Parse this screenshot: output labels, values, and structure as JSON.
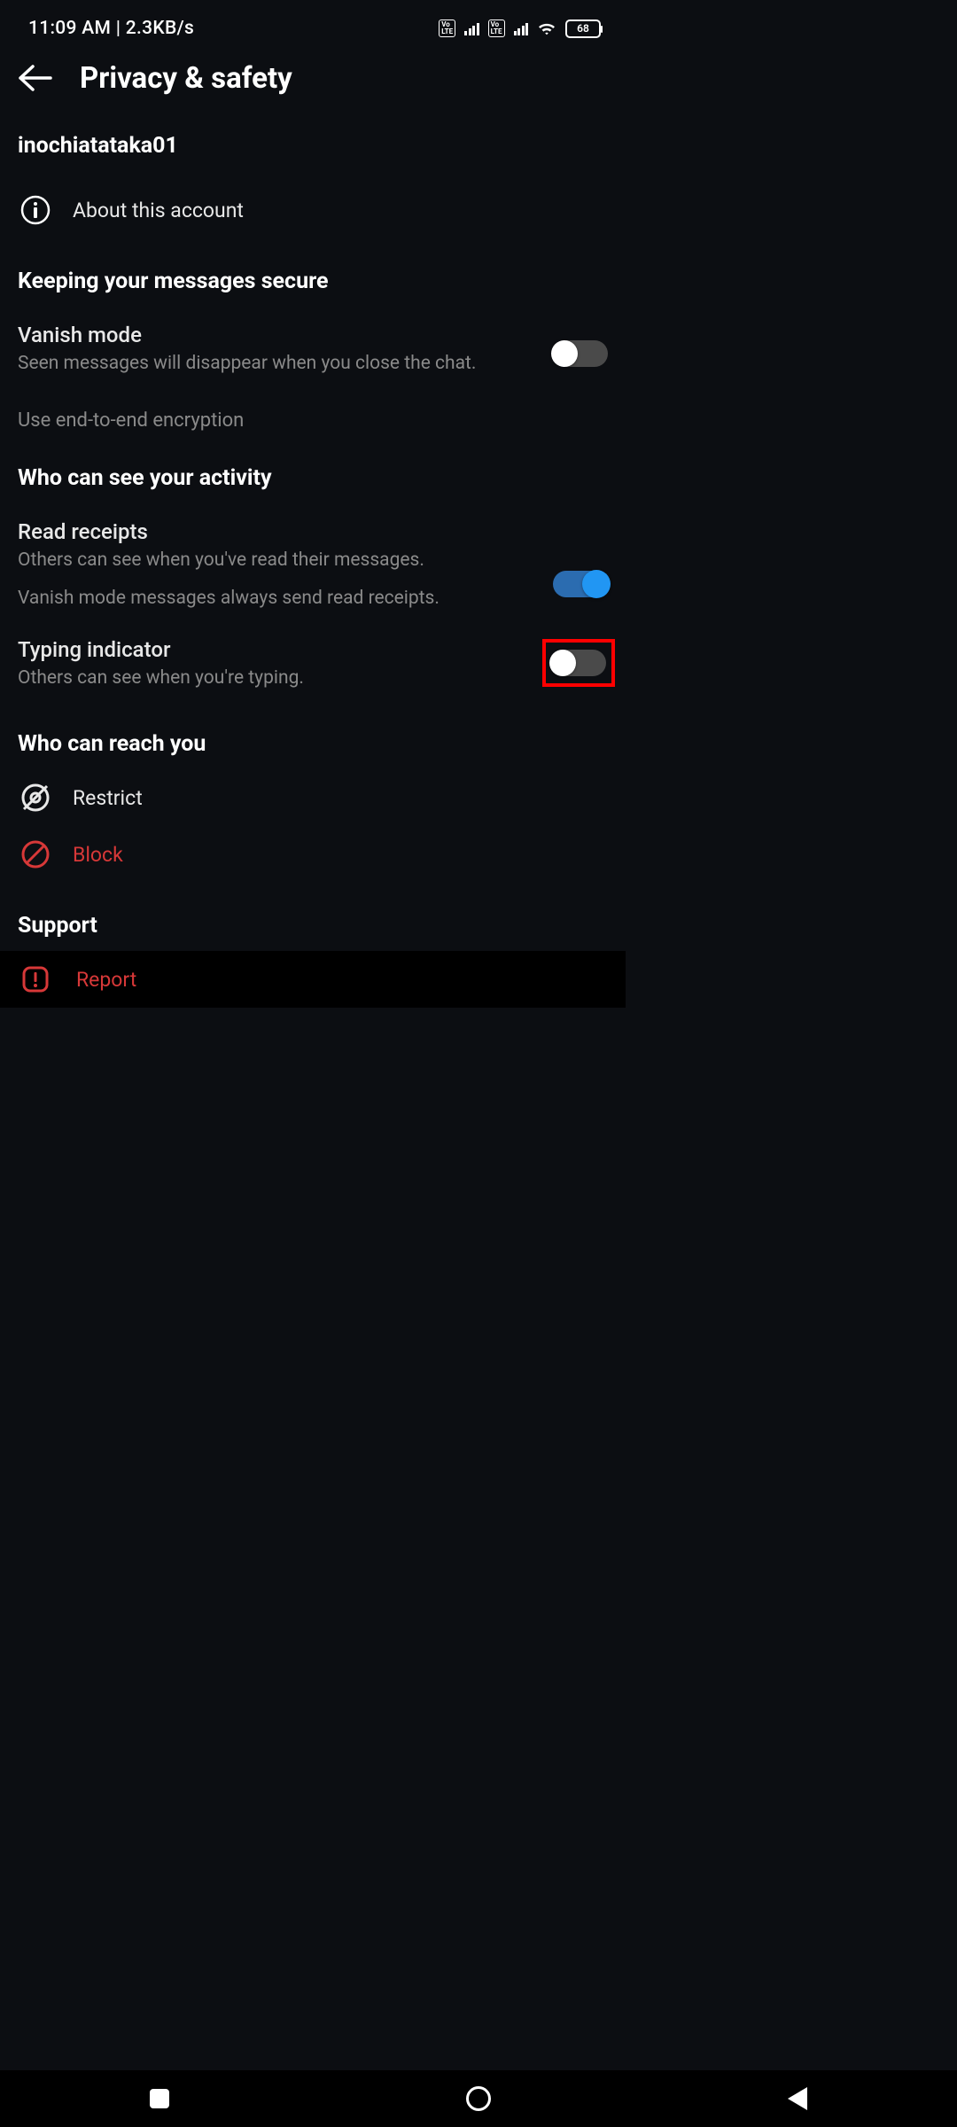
{
  "status": {
    "time": "11:09 AM",
    "net_speed": "2.3KB/s",
    "volte": "Vo\nLTE",
    "battery_pct": "68"
  },
  "header": {
    "title": "Privacy & safety"
  },
  "account": {
    "username": "inochiatataka01",
    "about_label": "About this account"
  },
  "sections": {
    "secure_heading": "Keeping your messages secure",
    "activity_heading": "Who can see your activity",
    "reach_heading": "Who can reach you",
    "support_heading": "Support"
  },
  "settings": {
    "vanish": {
      "title": "Vanish mode",
      "desc": "Seen messages will disappear when you close the chat.",
      "on": false
    },
    "e2e_label": "Use end-to-end encryption",
    "read_receipts": {
      "title": "Read receipts",
      "desc": "Others can see when you've read their messages.",
      "note": "Vanish mode messages always send read receipts.",
      "on": true
    },
    "typing": {
      "title": "Typing indicator",
      "desc": "Others can see when you're typing.",
      "on": false
    }
  },
  "actions": {
    "restrict": "Restrict",
    "block": "Block",
    "report": "Report"
  }
}
